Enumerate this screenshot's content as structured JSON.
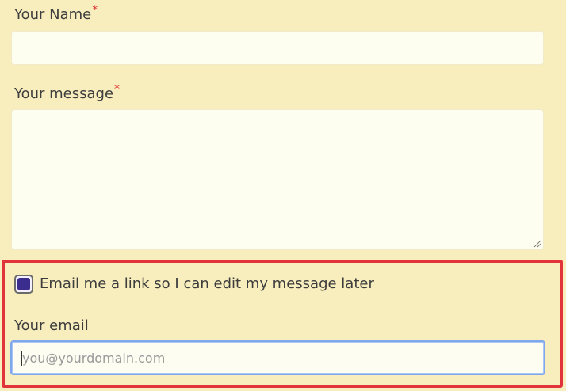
{
  "form": {
    "name_field": {
      "label": "Your Name",
      "required_marker": "*",
      "value": ""
    },
    "message_field": {
      "label": "Your message",
      "required_marker": "*",
      "value": ""
    },
    "email_link_option": {
      "checked": true,
      "label": "Email me a link so I can edit my message later"
    },
    "email_field": {
      "label": "Your email",
      "placeholder": "you@yourdomain.com",
      "value": ""
    }
  },
  "colors": {
    "background": "#f7edbd",
    "input_background": "#fdfdf0",
    "required_marker": "#e03131",
    "highlight_border": "#e0333b",
    "checkbox_fill": "#3b2d8e",
    "focus_border": "#7ea7ec"
  },
  "icons": {
    "resize_handle": "resize-handle-icon",
    "checkbox": "checkbox-checked-icon"
  }
}
